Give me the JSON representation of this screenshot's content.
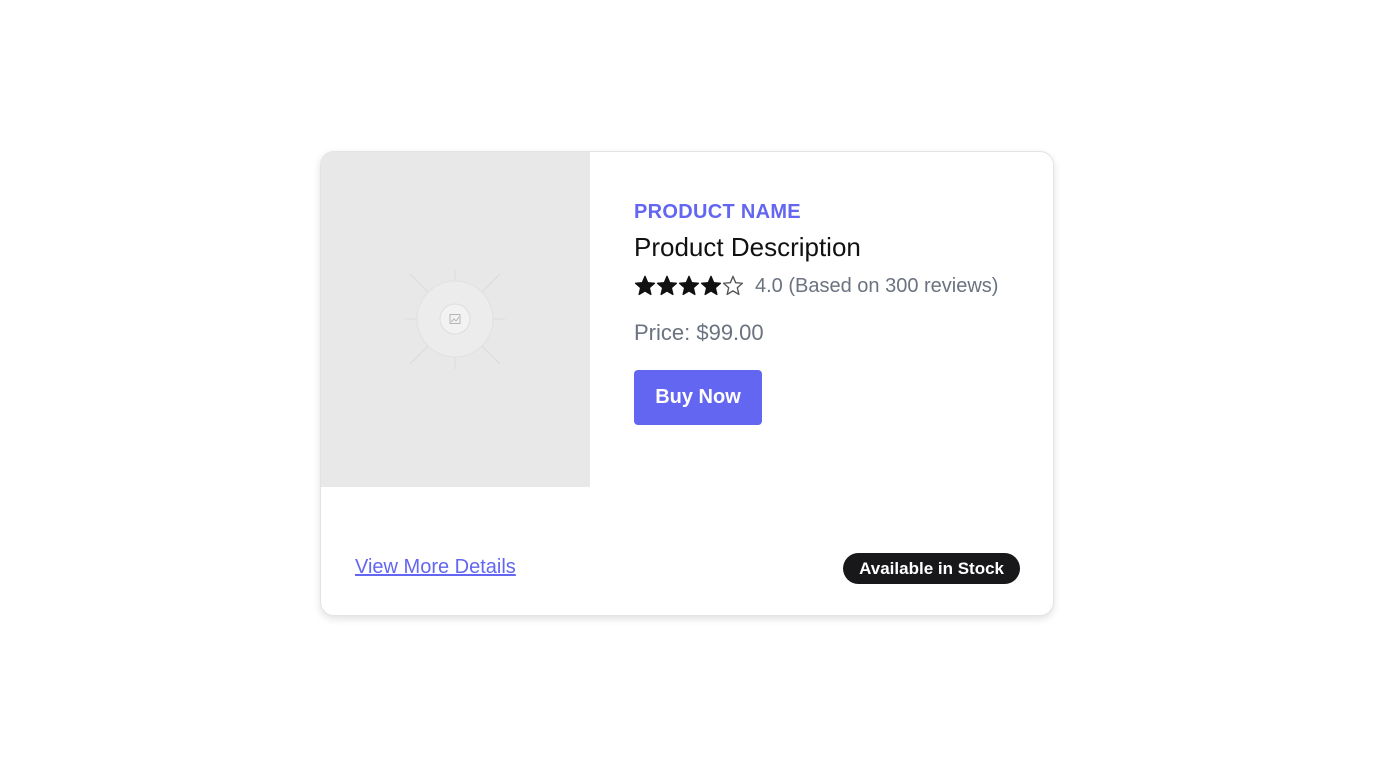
{
  "product": {
    "name": "PRODUCT NAME",
    "description": "Product Description",
    "rating_value": 4,
    "rating_max": 5,
    "rating_text": "4.0 (Based on 300 reviews)",
    "price_text": "Price: $99.00",
    "image_placeholder_icon": "image-placeholder-icon"
  },
  "actions": {
    "buy_label": "Buy Now",
    "details_label": "View More Details"
  },
  "status": {
    "stock_label": "Available in Stock"
  },
  "colors": {
    "accent": "#6366f1",
    "badge_bg": "#18181b",
    "muted_text": "#6b7280",
    "image_bg": "#e8e8e8"
  }
}
